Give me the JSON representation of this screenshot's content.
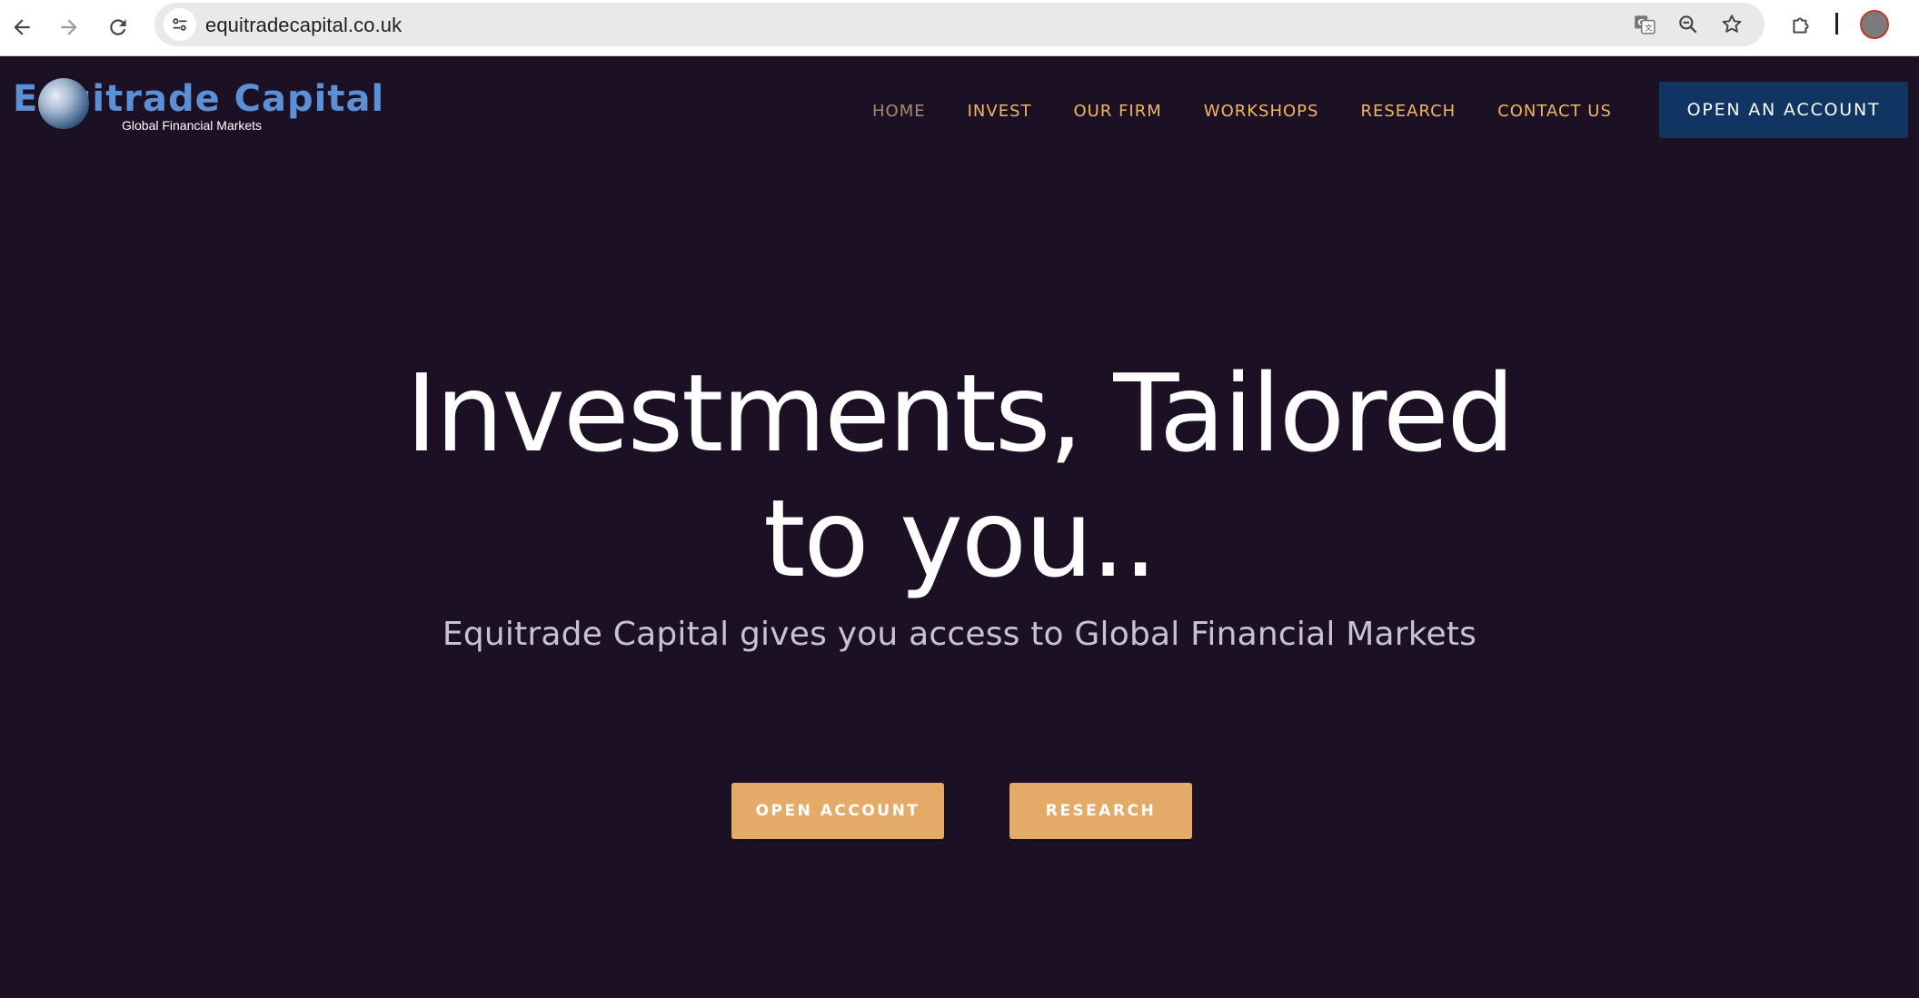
{
  "browser": {
    "url": "equitradecapital.co.uk",
    "icons": {
      "back": "arrow-left-icon",
      "forward": "arrow-right-icon",
      "reload": "reload-icon",
      "site_info": "tune-icon",
      "translate": "translate-icon",
      "zoom": "zoom-out-icon",
      "bookmark": "star-icon",
      "extensions": "puzzle-icon",
      "profile": "avatar"
    }
  },
  "header": {
    "logo": {
      "main_text": "Equitrade Capital",
      "sub_text": "Global Financial Markets"
    },
    "nav": [
      {
        "label": "HOME",
        "active": true
      },
      {
        "label": "INVEST",
        "active": false
      },
      {
        "label": "OUR FIRM",
        "active": false
      },
      {
        "label": "WORKSHOPS",
        "active": false
      },
      {
        "label": "RESEARCH",
        "active": false
      },
      {
        "label": "CONTACT US",
        "active": false
      }
    ],
    "cta_label": "OPEN AN ACCOUNT"
  },
  "hero": {
    "title_line1": "Investments, Tailored",
    "title_line2": "to you..",
    "subtitle": "Equitrade Capital gives you access to Global Financial Markets",
    "buttons": {
      "open_account": "OPEN ACCOUNT",
      "research": "RESEARCH"
    }
  },
  "colors": {
    "background": "#1c1124",
    "nav_link": "#f2b560",
    "nav_active": "#a48a6a",
    "header_cta_bg": "#103562",
    "hero_button_bg": "#e3ab67",
    "logo_blue": "#5b8fd6"
  }
}
